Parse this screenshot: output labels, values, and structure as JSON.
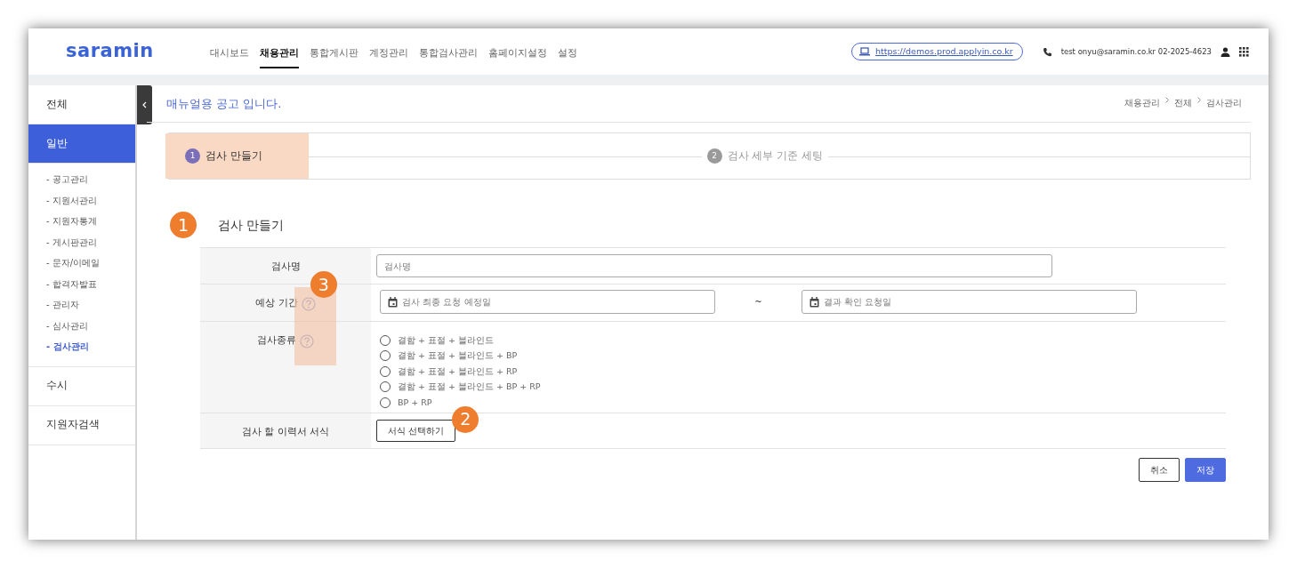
{
  "brand": "saramin",
  "top_nav": [
    {
      "label": "대시보드",
      "selected": false
    },
    {
      "label": "채용관리",
      "selected": true
    },
    {
      "label": "통합게시판",
      "selected": false
    },
    {
      "label": "계정관리",
      "selected": false
    },
    {
      "label": "통합검사관리",
      "selected": false
    },
    {
      "label": "홈페이지설정",
      "selected": false
    },
    {
      "label": "설정",
      "selected": false
    }
  ],
  "site_url": "https://demos.prod.applyin.co.kr",
  "contact": "test onyu@saramin.co.kr 02-2025-4623",
  "sidebar": {
    "items": [
      {
        "label": "전체",
        "selected": false
      },
      {
        "label": "일반",
        "selected": true,
        "children": [
          {
            "label": "- 공고관리",
            "selected": false
          },
          {
            "label": "- 지원서관리",
            "selected": false
          },
          {
            "label": "- 지원자통계",
            "selected": false
          },
          {
            "label": "- 게시판관리",
            "selected": false
          },
          {
            "label": "- 문자/이메일",
            "selected": false
          },
          {
            "label": "- 합격자발표",
            "selected": false
          },
          {
            "label": "- 관리자",
            "selected": false
          },
          {
            "label": "- 심사관리",
            "selected": false
          },
          {
            "label": "- 검사관리",
            "selected": true
          }
        ]
      },
      {
        "label": "수시",
        "selected": false
      },
      {
        "label": "지원자검색",
        "selected": false
      }
    ]
  },
  "page_title": "매뉴얼용 공고 입니다.",
  "breadcrumb": [
    "채용관리",
    "전체",
    "검사관리"
  ],
  "steps": [
    {
      "number": "1",
      "label": "검사 만들기",
      "selected": true
    },
    {
      "number": "2",
      "label": "검사 세부 기준 세팅",
      "selected": false
    }
  ],
  "section": {
    "callout": "1",
    "title": "검사 만들기"
  },
  "form": {
    "rows": [
      {
        "kind": "text",
        "label": "검사명",
        "placeholder": "검사명"
      },
      {
        "kind": "date_range",
        "label": "예상 기간",
        "help": true,
        "highlighted": true,
        "callout": "3",
        "start_placeholder": "검사 최종 요청 예정일",
        "separator": "~",
        "end_placeholder": "결과 확인 요청일"
      },
      {
        "kind": "radio",
        "label": "검사종류",
        "help": true,
        "highlighted": true,
        "options": [
          {
            "label": "결함 + 표절 + 블라인드",
            "selected": false
          },
          {
            "label": "결함 + 표절 + 블라인드 + BP",
            "selected": false
          },
          {
            "label": "결함 + 표절 + 블라인드 + RP",
            "selected": false
          },
          {
            "label": "결함 + 표절 + 블라인드 + BP + RP",
            "selected": false
          },
          {
            "label": "BP + RP",
            "selected": false
          }
        ]
      },
      {
        "kind": "button",
        "label": "검사 할 이력서 서식",
        "button": "서식 선택하기",
        "callout": "2"
      }
    ]
  },
  "actions": [
    {
      "kind": "secondary",
      "label": "취소"
    },
    {
      "kind": "primary",
      "label": "저장"
    }
  ]
}
